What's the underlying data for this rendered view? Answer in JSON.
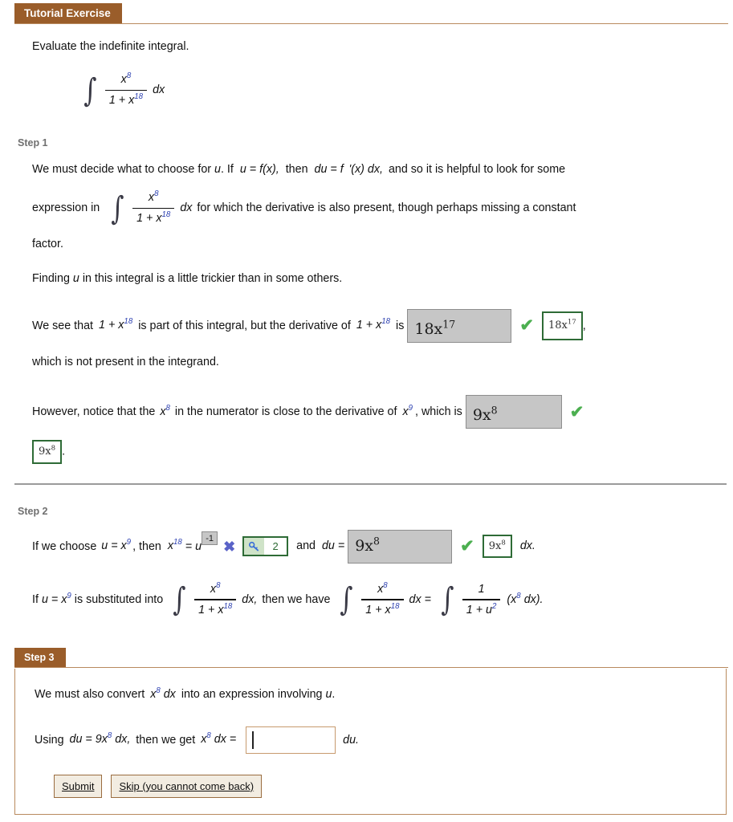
{
  "header": {
    "tab_label": "Tutorial Exercise"
  },
  "problem": {
    "instruction": "Evaluate the indefinite integral.",
    "integral": {
      "numerator": "x",
      "numerator_exp": "8",
      "denominator_lead": "1 + x",
      "denominator_exp": "18",
      "differential": "dx"
    }
  },
  "step1": {
    "label": "Step 1",
    "p1_a": "We must decide what to choose for",
    "p1_u": "u",
    "p1_b": ". If",
    "p1_eq1": "u = f(x),",
    "p1_c": "then",
    "p1_eq2": "du = f  '(x) dx,",
    "p1_d": "and so it is helpful to look for some",
    "p1_e": "expression in",
    "p1_f": "dx",
    "p1_g": "for which the derivative is also present, though perhaps missing a constant",
    "p1_h": "factor.",
    "p2_a": "Finding",
    "p2_u": "u",
    "p2_b": "in this integral is a little trickier than in some others.",
    "p3_a": "We see that",
    "p3_expr1": "1 + x",
    "p3_expr1_exp": "18",
    "p3_b": "is part of this integral, but the derivative of",
    "p3_expr2": "1 + x",
    "p3_expr2_exp": "18",
    "p3_c": "is",
    "p3_answer": "18x",
    "p3_answer_exp": "17",
    "p3_key": "18x",
    "p3_key_exp": "17",
    "p3_comma": ",",
    "p3_d": "which is not present in the integrand.",
    "p4_a": "However, notice that the",
    "p4_x": "x",
    "p4_x_exp": "8",
    "p4_b": "in the numerator is close to the derivative of",
    "p4_x2": "x",
    "p4_x2_exp": "9",
    "p4_c": ", which is",
    "p4_answer": "9x",
    "p4_answer_exp": "8",
    "p4_key": "9x",
    "p4_key_exp": "8",
    "p4_period": "."
  },
  "step2": {
    "label": "Step 2",
    "l1_a": "If we choose",
    "l1_u": "u = x",
    "l1_u_exp": "9",
    "l1_b": ", then",
    "l1_x": "x",
    "l1_x_exp": "18",
    "l1_eq": "= u",
    "l1_wrong_exp": "-1",
    "l1_hint_count": "2",
    "l1_c": "and",
    "l1_du": "du =",
    "l1_answer": "9x",
    "l1_answer_exp": "8",
    "l1_key": "9x",
    "l1_key_exp": "8",
    "l1_dx": "dx.",
    "l2_a": "If",
    "l2_u": "u = x",
    "l2_u_exp": "9",
    "l2_b": "is substituted into",
    "l2_dx1": "dx,",
    "l2_c": "then we have",
    "l2_dx2": "dx =",
    "l2_tail": "(x",
    "l2_tail_exp": "8",
    "l2_tail2": "dx).",
    "frac1": {
      "num": "x",
      "num_exp": "8",
      "den": "1 + x",
      "den_exp": "18"
    },
    "frac2": {
      "num": "x",
      "num_exp": "8",
      "den": "1 + x",
      "den_exp": "18"
    },
    "frac3": {
      "num": "1",
      "den": "1 + u",
      "den_exp": "2"
    }
  },
  "step3": {
    "label": "Step 3",
    "p1_a": "We must also convert",
    "p1_x": "x",
    "p1_x_exp": "8",
    "p1_dx": "dx",
    "p1_b": "into an expression involving",
    "p1_u": "u",
    "p1_period": ".",
    "p2_a": "Using",
    "p2_du": "du = 9x",
    "p2_du_exp": "8",
    "p2_dx": "dx,",
    "p2_b": "then we get",
    "p2_x": "x",
    "p2_x_exp": "8",
    "p2_dx2": "dx =",
    "input_value": "",
    "p2_tail": "du.",
    "submit_label": "Submit",
    "skip_label": "Skip (you cannot come back)"
  },
  "icons": {
    "check": "check-icon",
    "x": "x-icon",
    "key": "key-icon"
  },
  "colors": {
    "tab_brown": "#9a5d2a",
    "border_brown": "#b98a5e",
    "check_green": "#4caf50",
    "key_green": "#2e6b36",
    "x_blue": "#5a63c8",
    "math_blue": "#2b3fb0",
    "answer_gray": "#c6c6c6"
  }
}
